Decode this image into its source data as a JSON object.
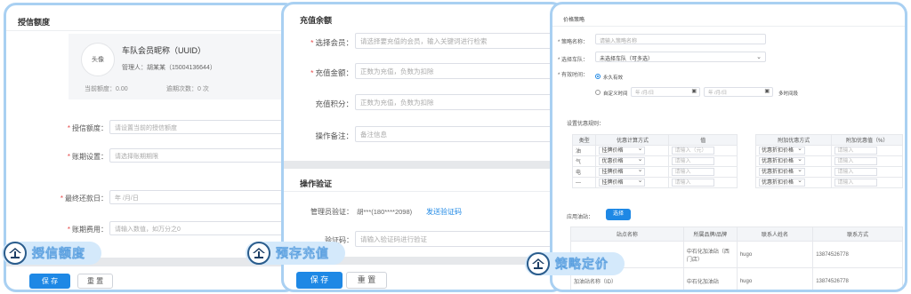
{
  "credit": {
    "title": "授信额度",
    "avatar": "头像",
    "company": "车队会员昵称（UUID）",
    "manager": "管理人：胡某某（15004136644）",
    "current_quota": "当前额度：0.00",
    "overdue": "逾期次数：0 次",
    "quota_label": "授信额度：",
    "quota_placeholder": "请设置当前的授信额度",
    "period_label": "账期设置：",
    "period_placeholder": "请选择账期期限",
    "due_label": "最终还款日：",
    "due_placeholder": "年 /月/日",
    "fee_label": "账期费用：",
    "fee_placeholder": "请输入数值，如万分之0",
    "save": "保 存",
    "reset": "重 置"
  },
  "recharge": {
    "title": "充值余额",
    "member_label": "选择会员：",
    "member_placeholder": "请选择要充值的会员，输入关键词进行检索",
    "amount_label": "充值金额：",
    "amount_placeholder": "正数为充值，负数为扣除",
    "points_label": "充值积分：",
    "points_placeholder": "正数为充值，负数为扣除",
    "remark_label": "操作备注：",
    "remark_placeholder": "备注信息",
    "verify_title": "操作验证",
    "admin_label": "管理员验证：",
    "admin_value": "胡***(180****2098)",
    "send_code": "发送验证码",
    "code_label": "验证码：",
    "code_placeholder": "请输入验证码进行验证",
    "save": "保 存",
    "reset": "重 置"
  },
  "strategy": {
    "title": "价格策略",
    "name_label": "* 策略名称：",
    "name_placeholder": "请输入策略名称",
    "fleet_label": "* 选择车队：",
    "fleet_value": "未选择车队（可多选）",
    "time_label": "* 有效时间：",
    "opt_forever": "永久有效",
    "opt_custom": "自定义时间",
    "date_start": "年 /月/日",
    "date_end": "年 /月/日",
    "multi_time": "多时间段",
    "rules_label": "设置优惠规则：",
    "table_headers": [
      "类型",
      "优惠计算方式",
      "值",
      "附加优惠方式",
      "附加优惠值（%）"
    ],
    "rows": [
      {
        "type": "油",
        "mode": "挂牌价格",
        "val": "请输入（元）",
        "extra": "优惠折扣价格",
        "extra_val": "请输入"
      },
      {
        "type": "气",
        "mode": "优惠价格",
        "val": "请输入",
        "extra": "优惠折扣价格",
        "extra_val": "请输入"
      },
      {
        "type": "电",
        "mode": "挂牌价格",
        "val": "请输入",
        "extra": "优惠折扣价格",
        "extra_val": "请输入"
      },
      {
        "type": "—",
        "mode": "挂牌价格",
        "val": "请输入",
        "extra": "优惠折扣价格",
        "extra_val": "请输入"
      }
    ],
    "apply_label": "应用油站：",
    "apply_button": "选择",
    "station_headers": [
      "站点名称",
      "所属品牌/品牌",
      "联系人姓名",
      "联系方式"
    ],
    "stations": [
      {
        "name": "",
        "brand": "中石化加油站（西门店）",
        "contact": "hugo",
        "phone": "13874526778"
      },
      {
        "name": "加油站名称（ID）",
        "brand": "中石化加油站",
        "contact": "hugo",
        "phone": "13874526778"
      }
    ]
  },
  "badges": {
    "credit": "授信额度",
    "recharge": "预存充值",
    "strategy": "策略定价"
  }
}
